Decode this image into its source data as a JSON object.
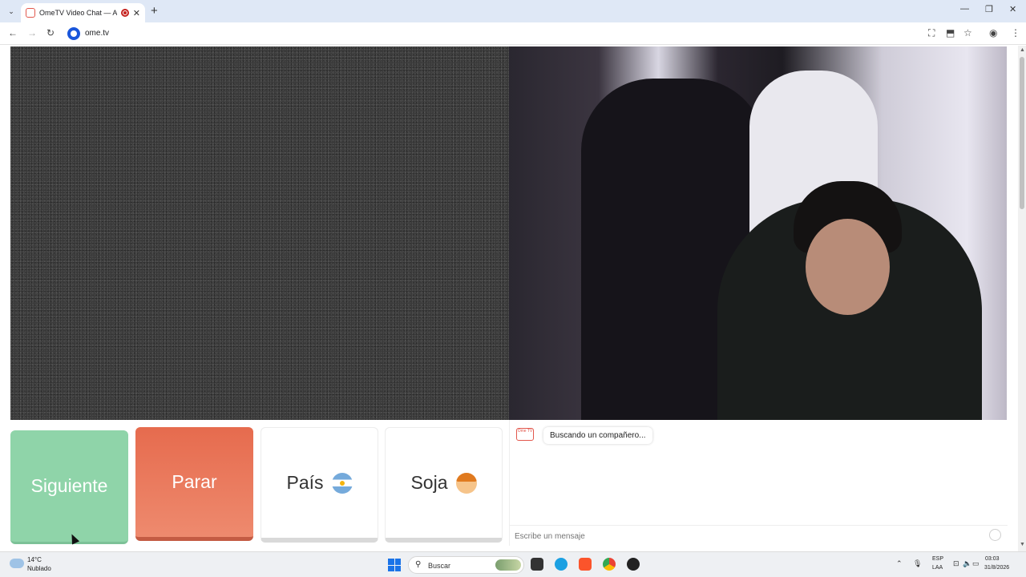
{
  "browser": {
    "tab_title": "OmeTV Video Chat — Alte",
    "tab_close": "✕",
    "new_tab": "+",
    "url": "ome.tv",
    "tab_menu_glyph": "⌄",
    "back_glyph": "←",
    "forward_glyph": "→",
    "reload_glyph": "↻",
    "window": {
      "minimize": "—",
      "restore": "❐",
      "close": "✕"
    },
    "toolbar_icons": {
      "translate": "⛶",
      "install": "⬒",
      "bookmark": "☆",
      "profile": "◉",
      "menu": "⋮"
    }
  },
  "controls": {
    "next_label": "Siguiente",
    "stop_label": "Parar",
    "country_label": "País",
    "gender_label": "Soja"
  },
  "chat": {
    "logo_text": "Ome TV",
    "status_message": "Buscando un compañero...",
    "input_placeholder": "Escribe un mensaje"
  },
  "scrollbar": {
    "up": "▲",
    "down": "▼"
  },
  "taskbar": {
    "weather_temp": "14°C",
    "weather_desc": "Nublado",
    "search_glyph": "⚲",
    "search_placeholder": "Buscar",
    "tray_chevron": "⌃",
    "tray_mic": "🎙",
    "tray_network": "⊡",
    "tray_volume": "🔈",
    "tray_battery": "▭",
    "lang_code": "ESP",
    "lang_region": "LAA",
    "time": "03:03",
    "date": "31/8/2026"
  },
  "colors": {
    "next_button": "#8fd4a9",
    "stop_button": "#e66b4e",
    "accent_red": "#e2574c",
    "site_blue": "#1a56db"
  }
}
